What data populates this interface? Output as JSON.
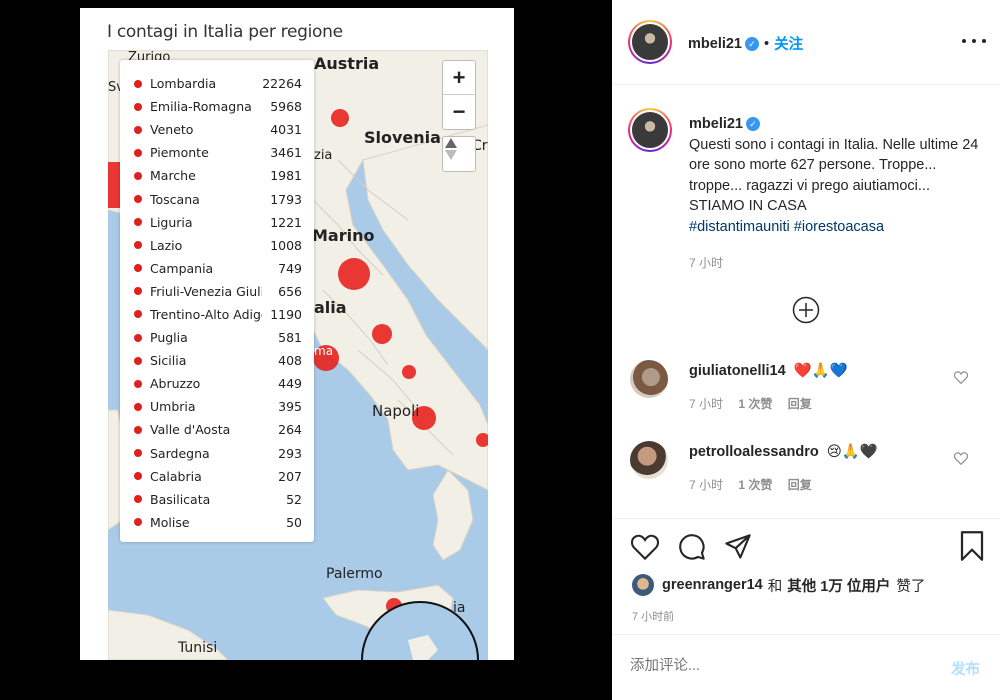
{
  "post_image": {
    "title": "I contagi in Italia per regione",
    "map_labels": {
      "zurigo": "Zurigo",
      "austria": "Austria",
      "slovenia": "Slovenia",
      "cr": "Cr",
      "sv": "Sv",
      "zia": "zia",
      "marino": "Marino",
      "alia": "alia",
      "ma": "ma",
      "napoli": "Napoli",
      "palermo": "Palermo",
      "tunisi": "Tunisi",
      "ia": "ia"
    },
    "zoom": {
      "in": "+",
      "out": "−"
    },
    "regions": [
      {
        "name": "Lombardia",
        "value": "22264"
      },
      {
        "name": "Emilia-Romagna",
        "value": "5968"
      },
      {
        "name": "Veneto",
        "value": "4031"
      },
      {
        "name": "Piemonte",
        "value": "3461"
      },
      {
        "name": "Marche",
        "value": "1981"
      },
      {
        "name": "Toscana",
        "value": "1793"
      },
      {
        "name": "Liguria",
        "value": "1221"
      },
      {
        "name": "Lazio",
        "value": "1008"
      },
      {
        "name": "Campania",
        "value": "749"
      },
      {
        "name": "Friuli-Venezia Giulia",
        "value": "656"
      },
      {
        "name": "Trentino-Alto Adige",
        "value": "1190"
      },
      {
        "name": "Puglia",
        "value": "581"
      },
      {
        "name": "Sicilia",
        "value": "408"
      },
      {
        "name": "Abruzzo",
        "value": "449"
      },
      {
        "name": "Umbria",
        "value": "395"
      },
      {
        "name": "Valle d'Aosta",
        "value": "264"
      },
      {
        "name": "Sardegna",
        "value": "293"
      },
      {
        "name": "Calabria",
        "value": "207"
      },
      {
        "name": "Basilicata",
        "value": "52"
      },
      {
        "name": "Molise",
        "value": "50"
      }
    ]
  },
  "header": {
    "username": "mbeli21",
    "separator": "•",
    "follow_label": "关注",
    "more_icon": "more-horizontal-icon"
  },
  "caption": {
    "username": "mbeli21",
    "text": "Questi sono i contagi in Italia. Nelle ultime 24 ore sono morte 627 persone. Troppe... troppe... ragazzi vi prego aiutiamoci... STIAMO IN CASA",
    "hashtags": [
      "#distantimauniti",
      "#iorestoacasa"
    ],
    "time": "7 小时"
  },
  "load_more_icon": "plus-circle-icon",
  "comments": [
    {
      "username": "giuliatonelli14",
      "text": "❤️🙏💙",
      "time": "7 小时",
      "likes": "1 次赞",
      "reply": "回复"
    },
    {
      "username": "petrolloalessandro",
      "text": "😢🙏🖤",
      "time": "7 小时",
      "likes": "1 次赞",
      "reply": "回复"
    }
  ],
  "actions": {
    "icons": [
      "heart-icon",
      "comment-icon",
      "share-icon",
      "bookmark-icon"
    ]
  },
  "likes": {
    "user": "greenranger14",
    "and": "和",
    "others": "其他 1万 位用户",
    "suffix": "赞了"
  },
  "post_time": "7 小时前",
  "comment_box": {
    "placeholder": "添加评论...",
    "post_label": "发布"
  },
  "colors": {
    "accent": "#0095f6",
    "marker": "#e0201d",
    "sea": "#a9cbe8",
    "land": "#f2efe6"
  }
}
